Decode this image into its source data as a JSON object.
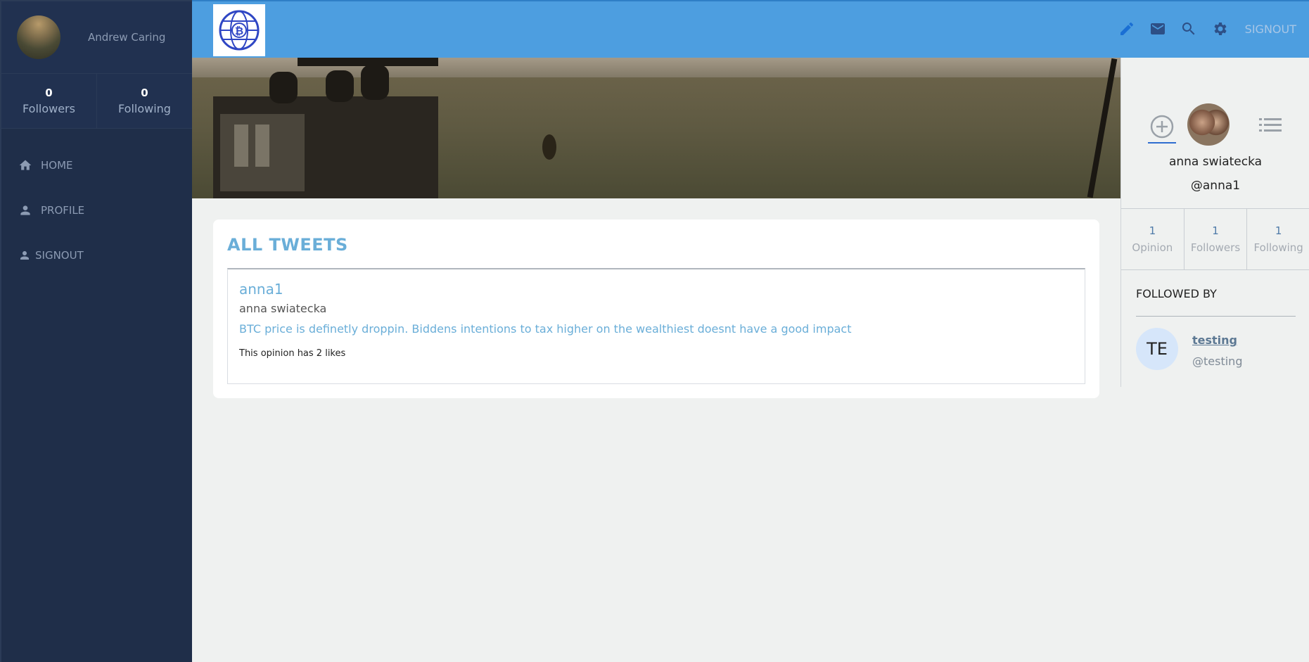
{
  "sidebar": {
    "user_name": "Andrew Caring",
    "followers_count": "0",
    "followers_label": "Followers",
    "following_count": "0",
    "following_label": "Following",
    "nav": [
      {
        "label": "HOME",
        "icon": "home-icon"
      },
      {
        "label": "PROFILE",
        "icon": "person-icon"
      },
      {
        "label": "SIGNOUT",
        "icon": "person-icon"
      }
    ]
  },
  "topbar": {
    "logo": "bitcoin-globe-logo",
    "icons": [
      "pencil-icon",
      "mail-icon",
      "search-icon",
      "gear-icon"
    ],
    "signout_label": "SIGNOUT",
    "accent": "#4d9ee0"
  },
  "main": {
    "section_title": "ALL TWEETS",
    "tweets": [
      {
        "handle": "anna1",
        "name": "anna swiatecka",
        "text": "BTC price is definetly droppin. Biddens intentions to tax higher on the wealthiest doesnt have a good impact",
        "likes_text": "This opinion has 2 likes"
      }
    ]
  },
  "profile_panel": {
    "name": "anna swiatecka",
    "handle": "@anna1",
    "stats": [
      {
        "value": "1",
        "label": "Opinion"
      },
      {
        "value": "1",
        "label": "Followers"
      },
      {
        "value": "1",
        "label": "Following"
      }
    ],
    "followed_by_title": "FOLLOWED BY",
    "followers": [
      {
        "initials": "TE",
        "name": "testing",
        "handle": "@testing"
      }
    ]
  }
}
